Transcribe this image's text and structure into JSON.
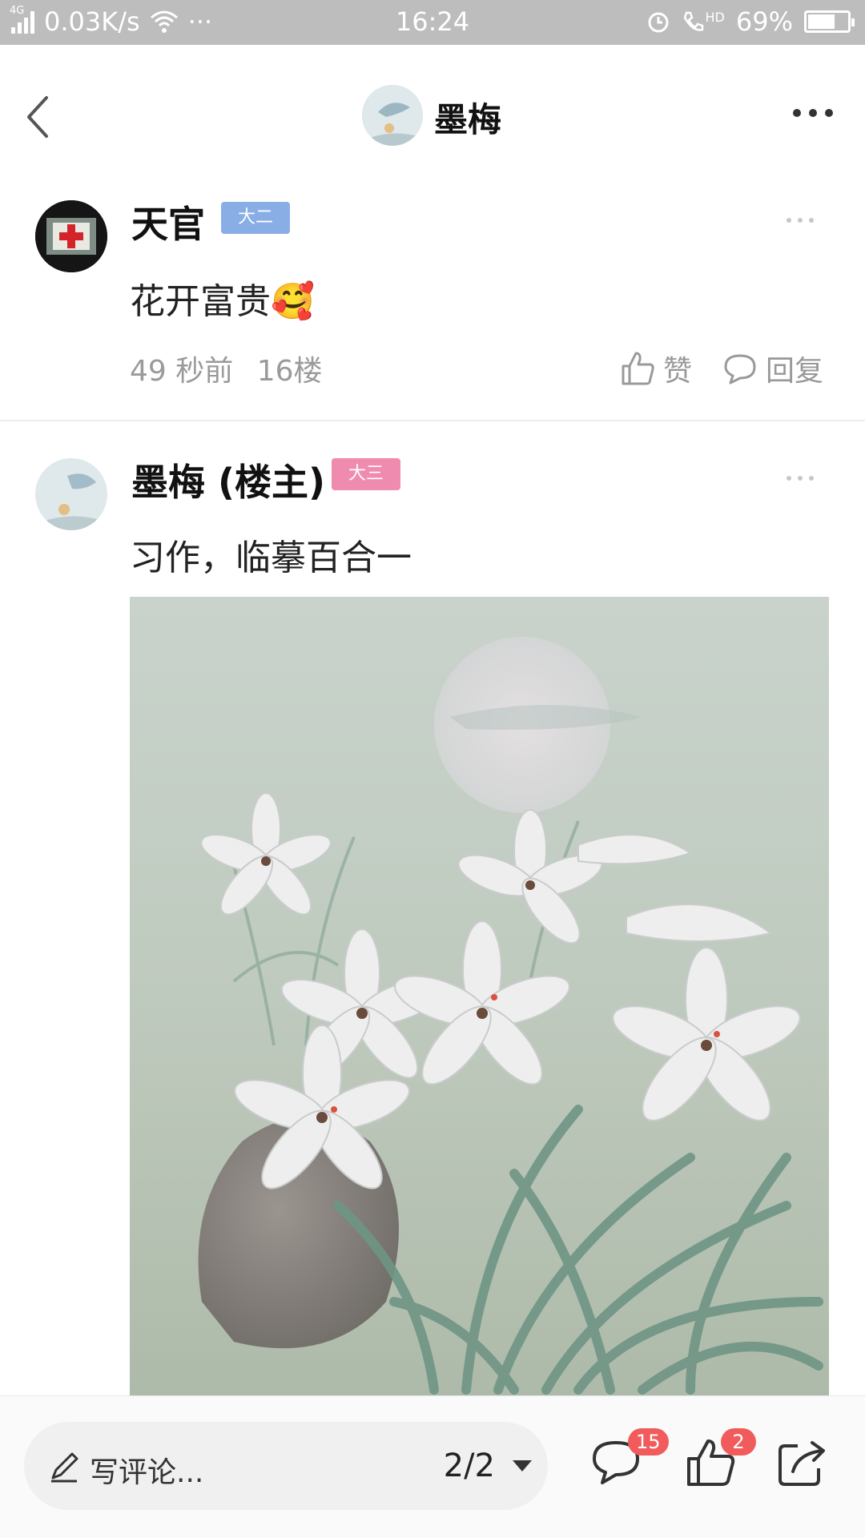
{
  "status_bar": {
    "network_tag": "4G",
    "speed": "0.03K/s",
    "extra": "···",
    "time": "16:24",
    "hd_tag": "HD",
    "battery": "69%",
    "battery_level": 0.69
  },
  "header": {
    "title": "墨梅"
  },
  "posts": [
    {
      "username": "天官",
      "badge": "大二",
      "text": "花开富贵",
      "emoji": "🥰",
      "time": "49 秒前",
      "floor": "16楼",
      "like_label": "赞",
      "reply_label": "回复"
    },
    {
      "username": "墨梅 (楼主)",
      "badge": "大三",
      "text": "习作，临摹百合一"
    }
  ],
  "bottom_bar": {
    "comment_placeholder": "写评论...",
    "page": "2/2",
    "comment_count": "15",
    "like_count": "2"
  },
  "colors": {
    "badge_blue": "#89aee6",
    "badge_pink": "#f08bb0",
    "count_badge_red": "#f25b5b"
  }
}
